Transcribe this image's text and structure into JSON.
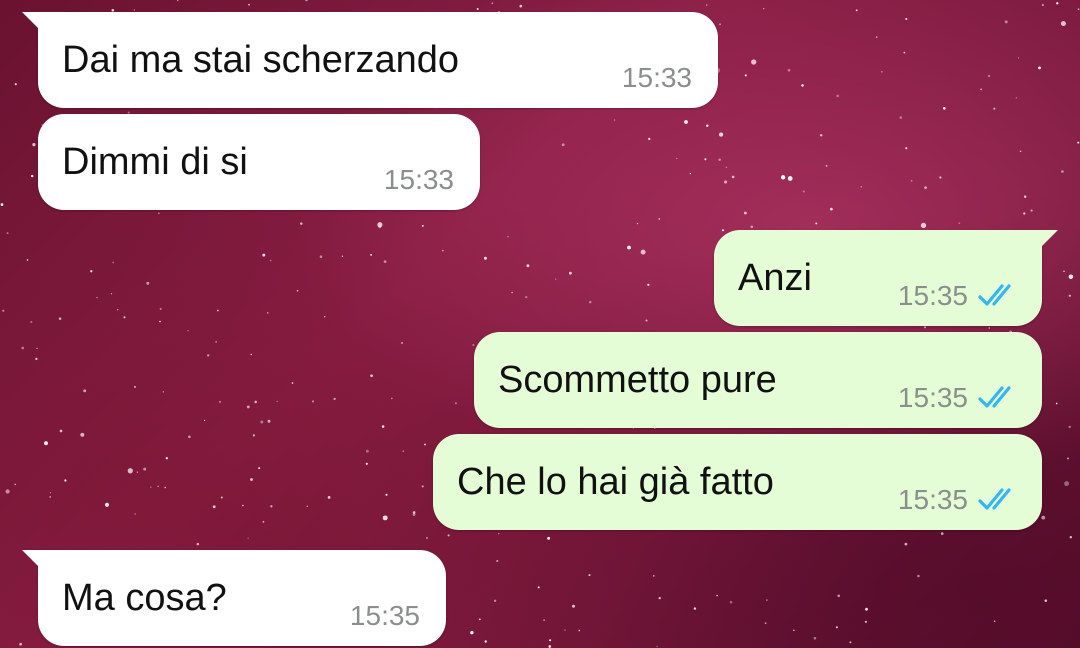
{
  "chat": {
    "messages": [
      {
        "direction": "incoming",
        "text": "Dai ma stai scherzando",
        "time": "15:33",
        "status": null
      },
      {
        "direction": "incoming",
        "text": "Dimmi di si",
        "time": "15:33",
        "status": null
      },
      {
        "direction": "outgoing",
        "text": "Anzi",
        "time": "15:35",
        "status": "read"
      },
      {
        "direction": "outgoing",
        "text": "Scommetto pure",
        "time": "15:35",
        "status": "read"
      },
      {
        "direction": "outgoing",
        "text": "Che lo hai già fatto",
        "time": "15:35",
        "status": "read"
      },
      {
        "direction": "incoming",
        "text": "Ma cosa?",
        "time": "15:35",
        "status": null
      }
    ]
  },
  "colors": {
    "incoming_bubble": "#ffffff",
    "outgoing_bubble": "#e5fdd6",
    "read_ticks": "#34b7f1",
    "time_text": "#8a8f8c",
    "wallpaper": "#7a1a3e"
  },
  "icons": {
    "read_status": "double-check-icon"
  }
}
